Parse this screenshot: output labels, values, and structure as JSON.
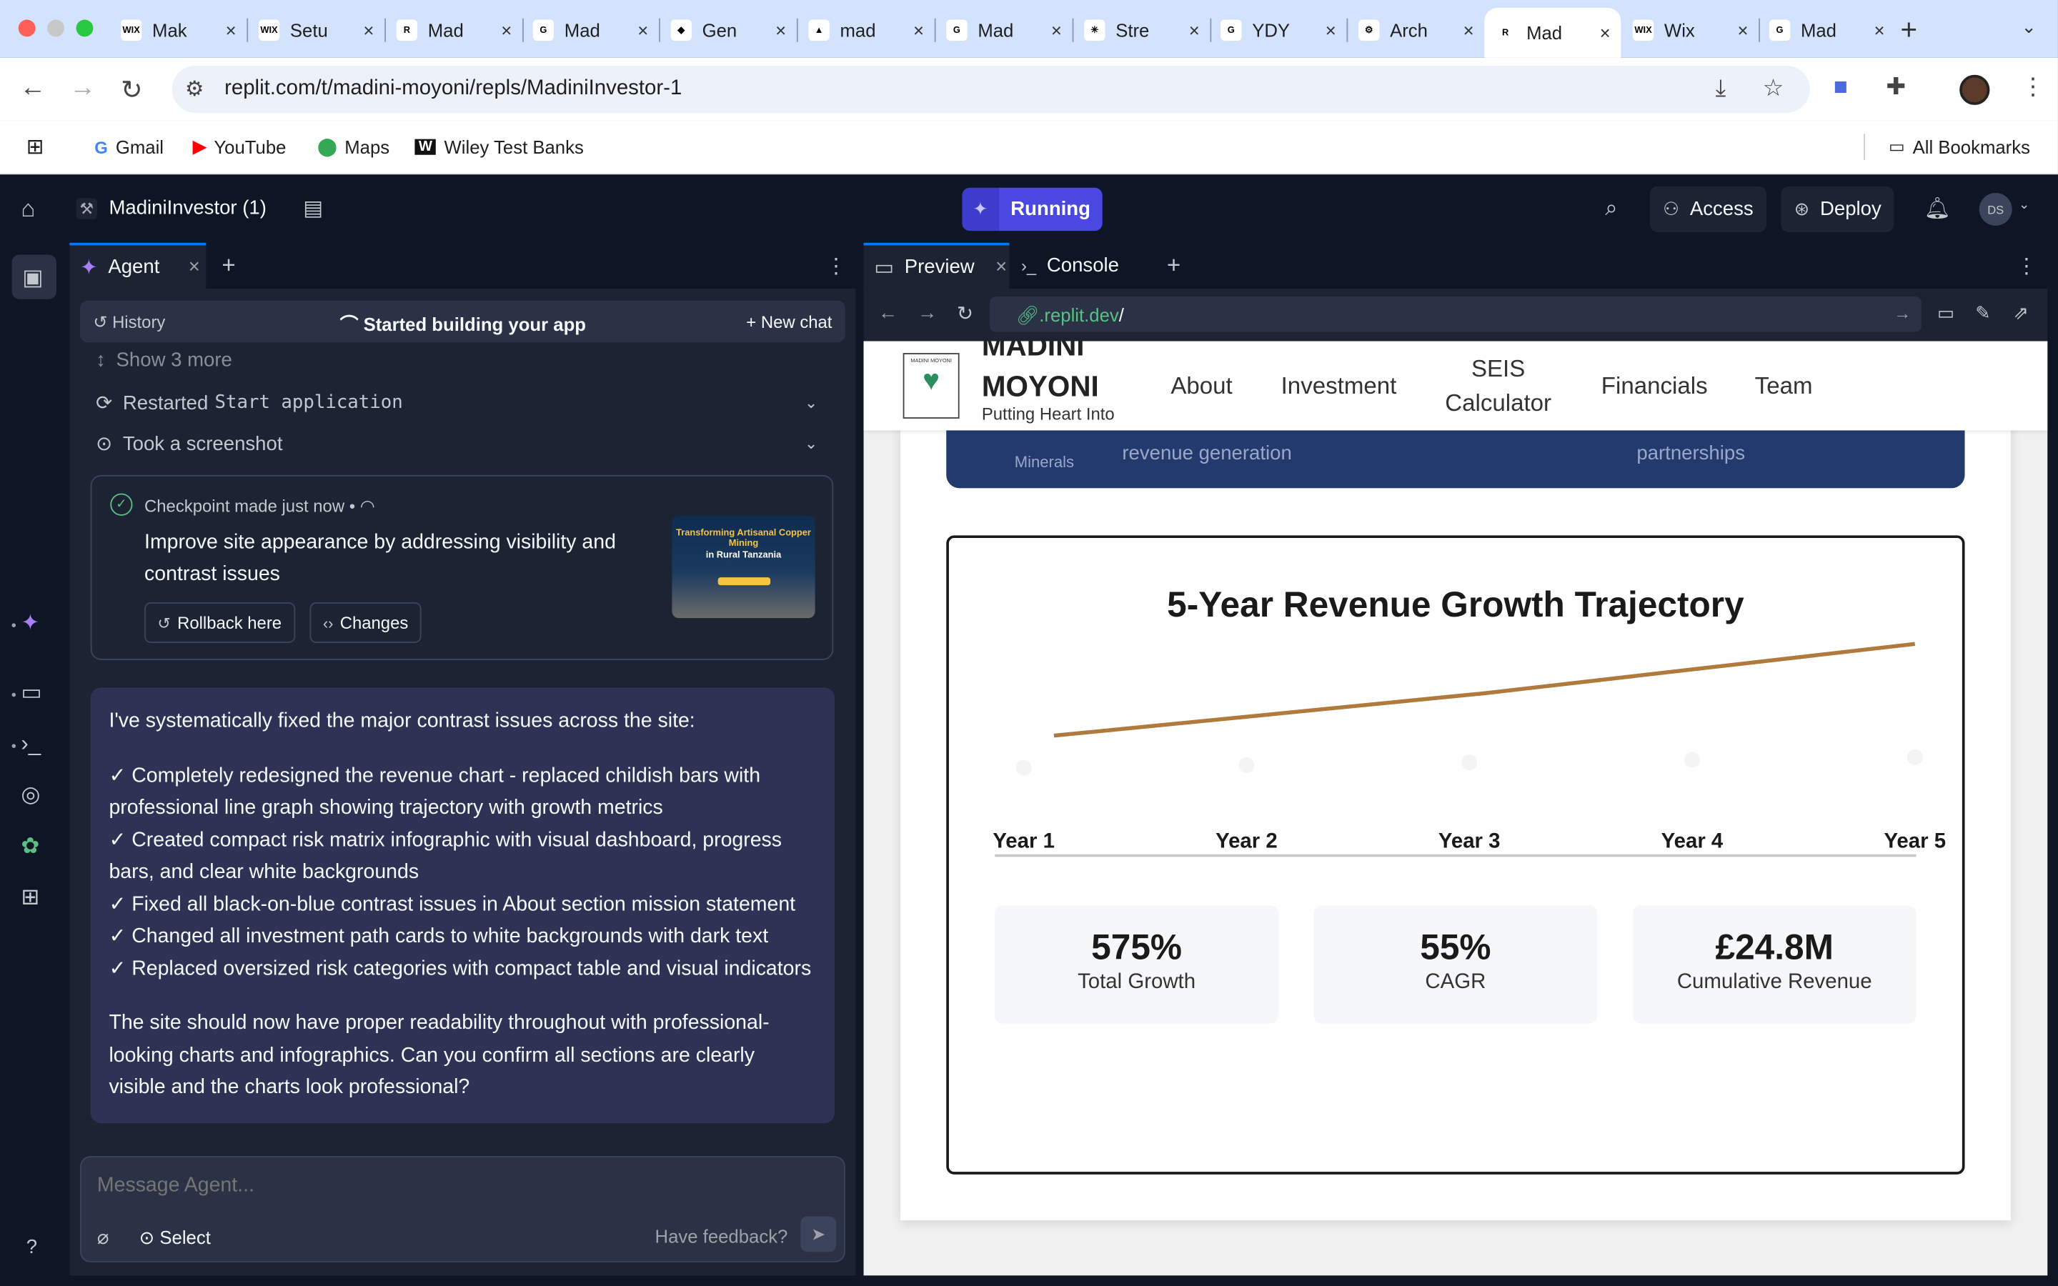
{
  "browser": {
    "tabs": [
      {
        "label": "Mak",
        "fav": "WIX"
      },
      {
        "label": "Setu",
        "fav": "WIX"
      },
      {
        "label": "Mad",
        "fav": "R"
      },
      {
        "label": "Mad",
        "fav": "G"
      },
      {
        "label": "Gen",
        "fav": "◆"
      },
      {
        "label": "mad",
        "fav": "▲"
      },
      {
        "label": "Mad",
        "fav": "G"
      },
      {
        "label": "Stre",
        "fav": "✳"
      },
      {
        "label": "YDY",
        "fav": "G"
      },
      {
        "label": "Arch",
        "fav": "⚙"
      },
      {
        "label": "Mad",
        "fav": "R"
      },
      {
        "label": "Wix",
        "fav": "WIX"
      },
      {
        "label": "Mad",
        "fav": "G"
      }
    ],
    "url": "replit.com/t/madini-moyoni/repls/MadiniInvestor-1",
    "bookmarks": [
      "Gmail",
      "YouTube",
      "Maps",
      "Wiley Test Banks"
    ],
    "all_bookmarks": "All Bookmarks"
  },
  "replit": {
    "repl_name": "MadiniInvestor (1)",
    "run_status": "Running",
    "access_label": "Access",
    "deploy_label": "Deploy",
    "avatar_initials": "DS"
  },
  "agent": {
    "tab_label": "Agent",
    "history_label": "History",
    "status": "Started building your app",
    "new_chat": "New chat",
    "show_more": "Show 3 more",
    "step_restarted": "Restarted",
    "step_restarted_cmd": "Start application",
    "step_screenshot": "Took a screenshot",
    "checkpoint_meta": "Checkpoint made just now  •",
    "checkpoint_desc": "Improve site appearance by addressing visibility and contrast issues",
    "rollback": "Rollback here",
    "changes": "Changes",
    "thumb_line1": "Transforming Artisanal Copper Mining",
    "thumb_line2": "in Rural Tanzania",
    "message_intro": "I've systematically fixed the major contrast issues across the site:",
    "message_items": [
      "✓ Completely redesigned the revenue chart - replaced childish bars with professional line graph showing trajectory with growth metrics",
      "✓ Created compact risk matrix infographic with visual dashboard, progress bars, and clear white backgrounds",
      "✓ Fixed all black-on-blue contrast issues in About section mission statement",
      "✓ Changed all investment path cards to white backgrounds with dark text",
      "✓ Replaced oversized risk categories with compact table and visual indicators"
    ],
    "message_outro": "The site should now have proper readability throughout with professional-looking charts and infographics. Can you confirm all sections are clearly visible and the charts look professional?",
    "composer_placeholder": "Message Agent...",
    "select_label": "Select",
    "feedback": "Have feedback?"
  },
  "preview": {
    "tab_preview": "Preview",
    "tab_console": "Console",
    "url_domain": ".replit.dev",
    "url_path": "/"
  },
  "site": {
    "brand_line1": "MADINI",
    "brand_line2": "MOYONI",
    "tagline": "Putting Heart Into",
    "tagline_cut": "Minerals",
    "nav": [
      "About",
      "Investment",
      "SEIS",
      "Calculator",
      "Financials",
      "Team"
    ],
    "blue_text_1": "revenue generation",
    "blue_text_2": "partnerships",
    "metrics": [
      {
        "value": "575%",
        "label": "Total Growth"
      },
      {
        "value": "55%",
        "label": "CAGR"
      },
      {
        "value": "£24.8M",
        "label": "Cumulative Revenue"
      }
    ]
  },
  "chart_data": {
    "type": "line",
    "title": "5-Year Revenue Growth Trajectory",
    "categories": [
      "Year 1",
      "Year 2",
      "Year 3",
      "Year 4",
      "Year 5"
    ],
    "series": [
      {
        "values": [
          1.0,
          1.6,
          2.2,
          2.9,
          3.6
        ],
        "color": "#b07a3c"
      }
    ],
    "xlabel": "",
    "ylabel": "",
    "grid": false,
    "legend": "none"
  }
}
